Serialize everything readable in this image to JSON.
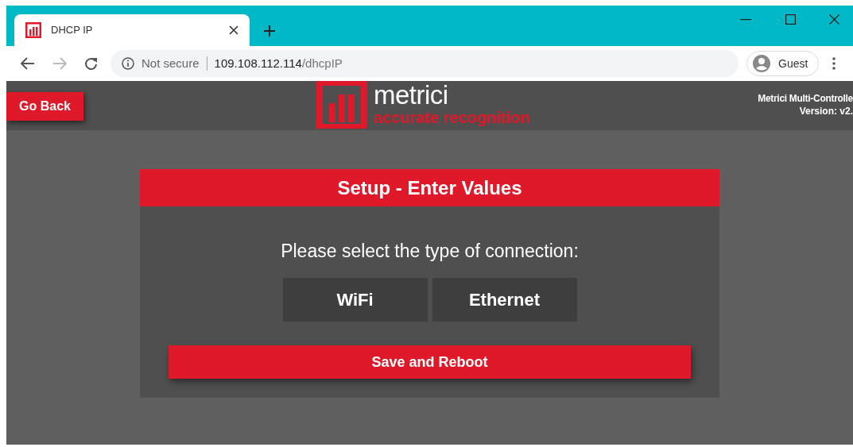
{
  "browser": {
    "tab": {
      "title": "DHCP IP",
      "selected": true
    },
    "address": {
      "security": "Not secure",
      "host": "109.108.112.114",
      "path": "/dhcpIP"
    },
    "profile": "Guest"
  },
  "header": {
    "back_button": "Go Back",
    "logo": {
      "name": "metrici",
      "tagline": "accurate recognition"
    },
    "product": "Metrici Multi-Controlle",
    "version": "Version: v2."
  },
  "card": {
    "title": "Setup - Enter Values",
    "prompt": "Please select the type of connection:",
    "options": [
      {
        "label": "WiFi",
        "selected": false
      },
      {
        "label": "Ethernet",
        "selected": false
      }
    ],
    "submit": "Save and Reboot"
  }
}
